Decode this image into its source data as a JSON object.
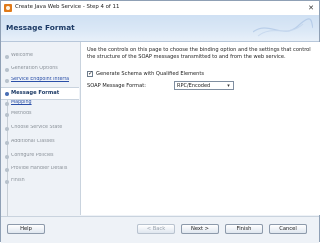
{
  "window": {
    "title": "Create Java Web Service - Step 4 of 11",
    "close_glyph": "✕"
  },
  "header": {
    "title": "Message Format"
  },
  "nav": {
    "items": [
      {
        "label": "Welcome",
        "state": "disabled"
      },
      {
        "label": "Generation Options",
        "state": "disabled"
      },
      {
        "label": "Service Endpoint Interfa",
        "state": "link"
      },
      {
        "label": "Message Format",
        "state": "current"
      },
      {
        "label": "Mapping",
        "state": "link"
      },
      {
        "label": "Methods",
        "state": "disabled"
      },
      {
        "label": "Choose Service State",
        "state": "disabled"
      },
      {
        "label": "Additional Classes",
        "state": "disabled"
      },
      {
        "label": "Configure Policies",
        "state": "disabled"
      },
      {
        "label": "Provide Handler Details",
        "state": "disabled"
      },
      {
        "label": "Finish",
        "state": "disabled"
      }
    ]
  },
  "content": {
    "description": "Use the controls on this page to choose the binding option and the settings that control the structure of the SOAP messages transmitted to and from the web service.",
    "schema_checkbox": {
      "label": "Generate Schema with Qualified Elements",
      "checked": true,
      "mark": "✓"
    },
    "format": {
      "label": "SOAP Message Format:",
      "value": "RPC/Encoded",
      "arrow": "▾"
    }
  },
  "buttons": {
    "help": "Help",
    "back": "< Back",
    "next": "Next >",
    "finish": "Finish",
    "cancel": "Cancel"
  }
}
